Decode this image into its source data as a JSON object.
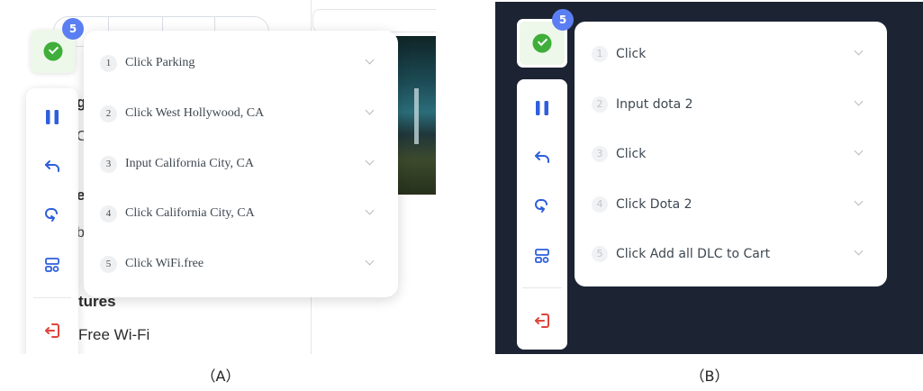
{
  "panel_a": {
    "badge_count": "5",
    "background": {
      "heading_fragment_1": "g",
      "heading_fragment_2": "C",
      "heading_fragment_3": "e",
      "text_fragment": "b",
      "section_title": "tures",
      "amenity": "Free Wi-Fi"
    },
    "toolbar": [
      {
        "icon": "pause-icon",
        "color": "#2f5fdc"
      },
      {
        "icon": "undo-icon",
        "color": "#2f5fdc"
      },
      {
        "icon": "redo-icon",
        "color": "#2f5fdc"
      },
      {
        "icon": "layout-icon",
        "color": "#2f5fdc"
      },
      {
        "icon": "exit-icon",
        "color": "#e0443c"
      }
    ],
    "steps": [
      {
        "number": "1",
        "label": "Click Parking"
      },
      {
        "number": "2",
        "label": "Click West Hollywood, CA"
      },
      {
        "number": "3",
        "label": "Input California City, CA"
      },
      {
        "number": "4",
        "label": "Click California City, CA"
      },
      {
        "number": "5",
        "label": "Click WiFi.free"
      }
    ]
  },
  "panel_b": {
    "badge_count": "5",
    "steps": [
      {
        "number": "1",
        "label": "Click"
      },
      {
        "number": "2",
        "label": "Input dota 2"
      },
      {
        "number": "3",
        "label": "Click"
      },
      {
        "number": "4",
        "label": "Click Dota 2"
      },
      {
        "number": "5",
        "label": "Click Add all DLC to Cart"
      }
    ]
  },
  "captions": {
    "a": "（A）",
    "b": "（B）"
  },
  "colors": {
    "accent_blue": "#2f5fdc",
    "badge_blue": "#5b7ff2",
    "success_green": "#3fae3a",
    "exit_red": "#e0443c",
    "dark_bg": "#1c2433"
  }
}
